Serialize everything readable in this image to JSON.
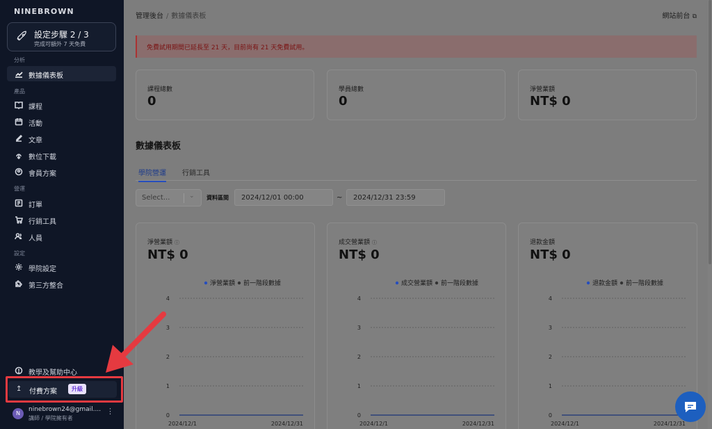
{
  "sidebar": {
    "brand": "NINEBROWN",
    "setup": {
      "title": "設定步驟 2 / 3",
      "subtitle": "完成可額外 7 天免費"
    },
    "sections": [
      "分析",
      "產品",
      "營運",
      "設定"
    ],
    "items": [
      {
        "label": "數據儀表板",
        "icon": "chart-icon"
      },
      {
        "label": "課程",
        "icon": "book-icon"
      },
      {
        "label": "活動",
        "icon": "calendar-icon"
      },
      {
        "label": "文章",
        "icon": "edit-icon"
      },
      {
        "label": "數位下載",
        "icon": "download-icon"
      },
      {
        "label": "會員方案",
        "icon": "member-icon"
      },
      {
        "label": "訂單",
        "icon": "orders-icon"
      },
      {
        "label": "行銷工具",
        "icon": "cart-icon"
      },
      {
        "label": "人員",
        "icon": "users-icon"
      },
      {
        "label": "學院設定",
        "icon": "gear-icon"
      },
      {
        "label": "第三方整合",
        "icon": "puzzle-icon"
      }
    ],
    "help": "教學及幫助中心",
    "upgrade": {
      "label": "付費方案",
      "badge": "升級"
    },
    "user": {
      "initial": "N",
      "email": "ninebrown24@gmail....",
      "role": "講師 / 學院擁有者"
    }
  },
  "header": {
    "breadcrumb": [
      "管理後台",
      "數據儀表板"
    ],
    "front_link": "網站前台"
  },
  "alert": "免費試用期間已延長至 21 天，目前尚有 21 天免費試用。",
  "stats": [
    {
      "label": "課程總數",
      "value": "0"
    },
    {
      "label": "學員總數",
      "value": "0"
    },
    {
      "label": "淨營業額",
      "value": "NT$ 0"
    }
  ],
  "dashboard": {
    "title": "數據儀表板",
    "tabs": [
      "學院營運",
      "行銷工具"
    ],
    "filter": {
      "select_placeholder": "Select...",
      "range_label": "資料區間",
      "start": "2024/12/01 00:00",
      "end": "2024/12/31 23:59",
      "tilde": "~"
    }
  },
  "colors": {
    "accent": "#264ebd",
    "danger": "#e53a40",
    "sidebar": "#0f1626"
  },
  "chart_data": [
    {
      "type": "line",
      "title": "淨營業額",
      "value": "NT$ 0",
      "series": [
        {
          "name": "淨營業額",
          "values": [
            0,
            0
          ]
        },
        {
          "name": "前一階段數據",
          "values": [
            0,
            0
          ]
        }
      ],
      "x": [
        "2024/12/1",
        "2024/12/31"
      ],
      "ylim": [
        0,
        4
      ],
      "yticks": [
        "0",
        "1",
        "2",
        "3",
        "4"
      ],
      "legend": "top-right"
    },
    {
      "type": "line",
      "title": "成交營業額",
      "value": "NT$ 0",
      "series": [
        {
          "name": "成交營業額",
          "values": [
            0,
            0
          ]
        },
        {
          "name": "前一階段數據",
          "values": [
            0,
            0
          ]
        }
      ],
      "x": [
        "2024/12/1",
        "2024/12/31"
      ],
      "ylim": [
        0,
        4
      ],
      "yticks": [
        "0",
        "1",
        "2",
        "3",
        "4"
      ],
      "legend": "top-right"
    },
    {
      "type": "line",
      "title": "退款金額",
      "value": "NT$ 0",
      "series": [
        {
          "name": "退款金額",
          "values": [
            0,
            0
          ]
        },
        {
          "name": "前一階段數據",
          "values": [
            0,
            0
          ]
        }
      ],
      "x": [
        "2024/12/1",
        "2024/12/31"
      ],
      "ylim": [
        0,
        4
      ],
      "yticks": [
        "0",
        "1",
        "2",
        "3",
        "4"
      ],
      "legend": "top-right"
    }
  ]
}
